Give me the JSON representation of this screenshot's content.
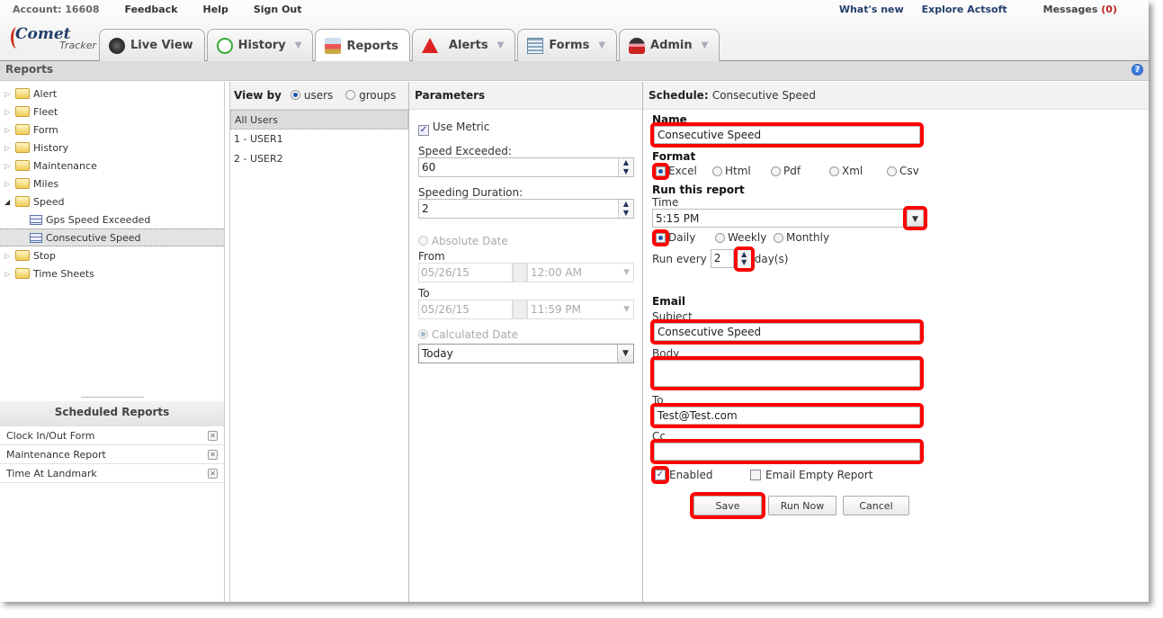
{
  "topbar": {
    "account": "Account: 16608",
    "links": [
      "Feedback",
      "Help",
      "Sign Out"
    ],
    "right_links": [
      "What's new",
      "Explore Actsoft"
    ],
    "messages_label": "Messages",
    "messages_count": "(0)"
  },
  "logo": {
    "brand": "Comet",
    "sub": "Tracker"
  },
  "tabs": [
    {
      "label": "Live View",
      "icon": "live-view-icon",
      "has_menu": false
    },
    {
      "label": "History",
      "icon": "history-icon",
      "has_menu": true
    },
    {
      "label": "Reports",
      "icon": "reports-icon",
      "has_menu": false,
      "active": true
    },
    {
      "label": "Alerts",
      "icon": "alert-icon",
      "has_menu": true
    },
    {
      "label": "Forms",
      "icon": "forms-icon",
      "has_menu": true
    },
    {
      "label": "Admin",
      "icon": "admin-icon",
      "has_menu": true
    }
  ],
  "section_title": "Reports",
  "help_icon": "?",
  "tree": {
    "folders": [
      "Alert",
      "Fleet",
      "Form",
      "History",
      "Maintenance",
      "Miles",
      "Speed",
      "Stop",
      "Time Sheets"
    ],
    "speed_children": [
      "Gps Speed Exceeded",
      "Consecutive Speed"
    ],
    "selected": "Consecutive Speed"
  },
  "scheduled_reports": {
    "title": "Scheduled Reports",
    "items": [
      "Clock In/Out Form",
      "Maintenance Report",
      "Time At Landmark"
    ],
    "remove_glyph": "✕"
  },
  "view_by": {
    "label": "View by",
    "options": [
      "users",
      "groups"
    ],
    "selected": "users",
    "users": [
      "All Users",
      "1 - USER1",
      "2 - USER2"
    ]
  },
  "parameters": {
    "title": "Parameters",
    "use_metric_label": "Use Metric",
    "use_metric": true,
    "speed_exceeded_label": "Speed Exceeded:",
    "speed_exceeded": "60",
    "speeding_duration_label": "Speeding Duration:",
    "speeding_duration": "2",
    "absolute_date_label": "Absolute Date",
    "from_label": "From",
    "from_date": "05/26/15",
    "from_time": "12:00 AM",
    "to_label": "To",
    "to_date": "05/26/15",
    "to_time": "11:59 PM",
    "calculated_date_label": "Calculated Date",
    "calculated_date": "Today"
  },
  "schedule": {
    "title_prefix": "Schedule:",
    "title_value": "Consecutive Speed",
    "name_label": "Name",
    "name_value": "Consecutive Speed",
    "format_label": "Format",
    "formats": [
      "Excel",
      "Html",
      "Pdf",
      "Xml",
      "Csv"
    ],
    "format_selected": "Excel",
    "run_label": "Run this report",
    "time_label": "Time",
    "time_value": "5:15 PM",
    "frequencies": [
      "Daily",
      "Weekly",
      "Monthly"
    ],
    "frequency_selected": "Daily",
    "run_every_label": "Run every",
    "run_every_value": "2",
    "run_every_unit": "day(s)",
    "email_label": "Email",
    "subject_label": "Subject",
    "subject_value": "Consecutive Speed",
    "body_label": "Body",
    "body_value": "",
    "to_label": "To",
    "to_value": "Test@Test.com",
    "cc_label": "Cc",
    "cc_value": "",
    "enabled_label": "Enabled",
    "enabled": true,
    "email_empty_label": "Email Empty Report",
    "email_empty": false,
    "save_label": "Save",
    "run_now_label": "Run Now",
    "cancel_label": "Cancel"
  },
  "colors": {
    "highlight": "#ff0000",
    "link": "#233f6b",
    "messages_count": "#bb2222"
  }
}
